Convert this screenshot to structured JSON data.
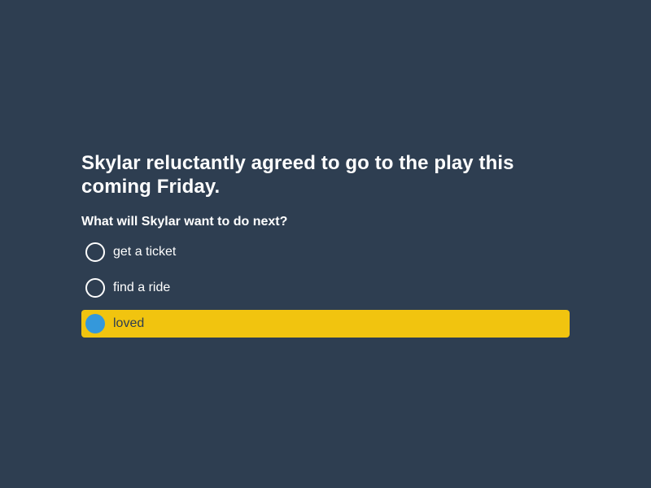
{
  "prompt": "Skylar reluctantly agreed to go to the play this coming Friday.",
  "question": "What will Skylar want to do next?",
  "options": [
    {
      "label": "get a ticket",
      "selected": false
    },
    {
      "label": "find a ride",
      "selected": false
    },
    {
      "label": "loved",
      "selected": true
    }
  ],
  "colors": {
    "background": "#2e3e51",
    "text": "#ffffff",
    "selected_highlight": "#f1c40f",
    "selected_radio": "#3498db"
  }
}
